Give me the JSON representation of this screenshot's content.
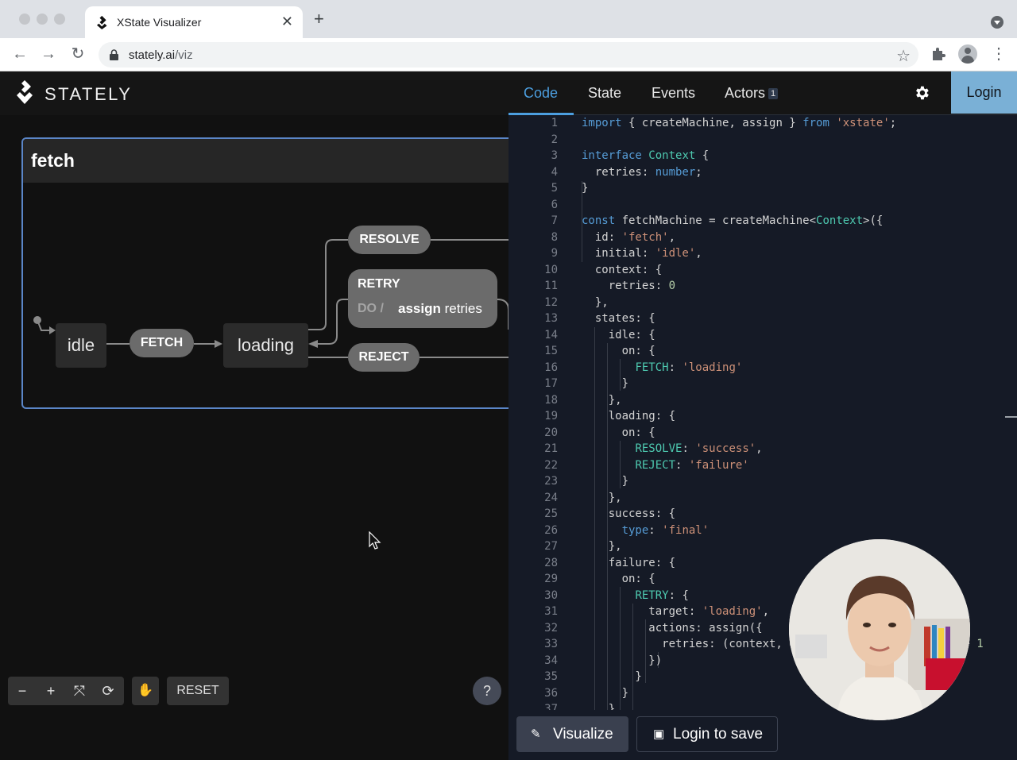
{
  "browser": {
    "tab_title": "XState Visualizer",
    "url_host": "stately.ai",
    "url_path": "/viz"
  },
  "app": {
    "brand": "STATELY",
    "tabs": [
      {
        "label": "Code",
        "active": true
      },
      {
        "label": "State"
      },
      {
        "label": "Events"
      },
      {
        "label": "Actors",
        "badge": "1"
      }
    ],
    "login_label": "Login",
    "accent_color": "#4c9fe0"
  },
  "diagram": {
    "machine_title": "fetch",
    "states": {
      "idle": "idle",
      "loading": "loading"
    },
    "events": {
      "fetch": "FETCH",
      "resolve": "RESOLVE",
      "retry": "RETRY",
      "reject": "REJECT"
    },
    "retry_do": "DO /",
    "retry_action_keyword": "assign",
    "retry_action_target": " retries"
  },
  "controls": {
    "zoom_out": "−",
    "zoom_in": "+",
    "fit": "⤧",
    "refresh": "⟳",
    "hand": "✋",
    "reset_label": "RESET",
    "help": "?"
  },
  "editor": {
    "lines": [
      "1",
      "2",
      "3",
      "4",
      "5",
      "6",
      "7",
      "8",
      "9",
      "10",
      "11",
      "12",
      "13",
      "14",
      "15",
      "16",
      "17",
      "18",
      "19",
      "20",
      "21",
      "22",
      "23",
      "24",
      "25",
      "26",
      "27",
      "28",
      "29",
      "30",
      "31",
      "32",
      "33",
      "34",
      "35",
      "36",
      "37"
    ]
  },
  "bottom": {
    "visualize_label": "Visualize",
    "save_label": "Login to save"
  }
}
